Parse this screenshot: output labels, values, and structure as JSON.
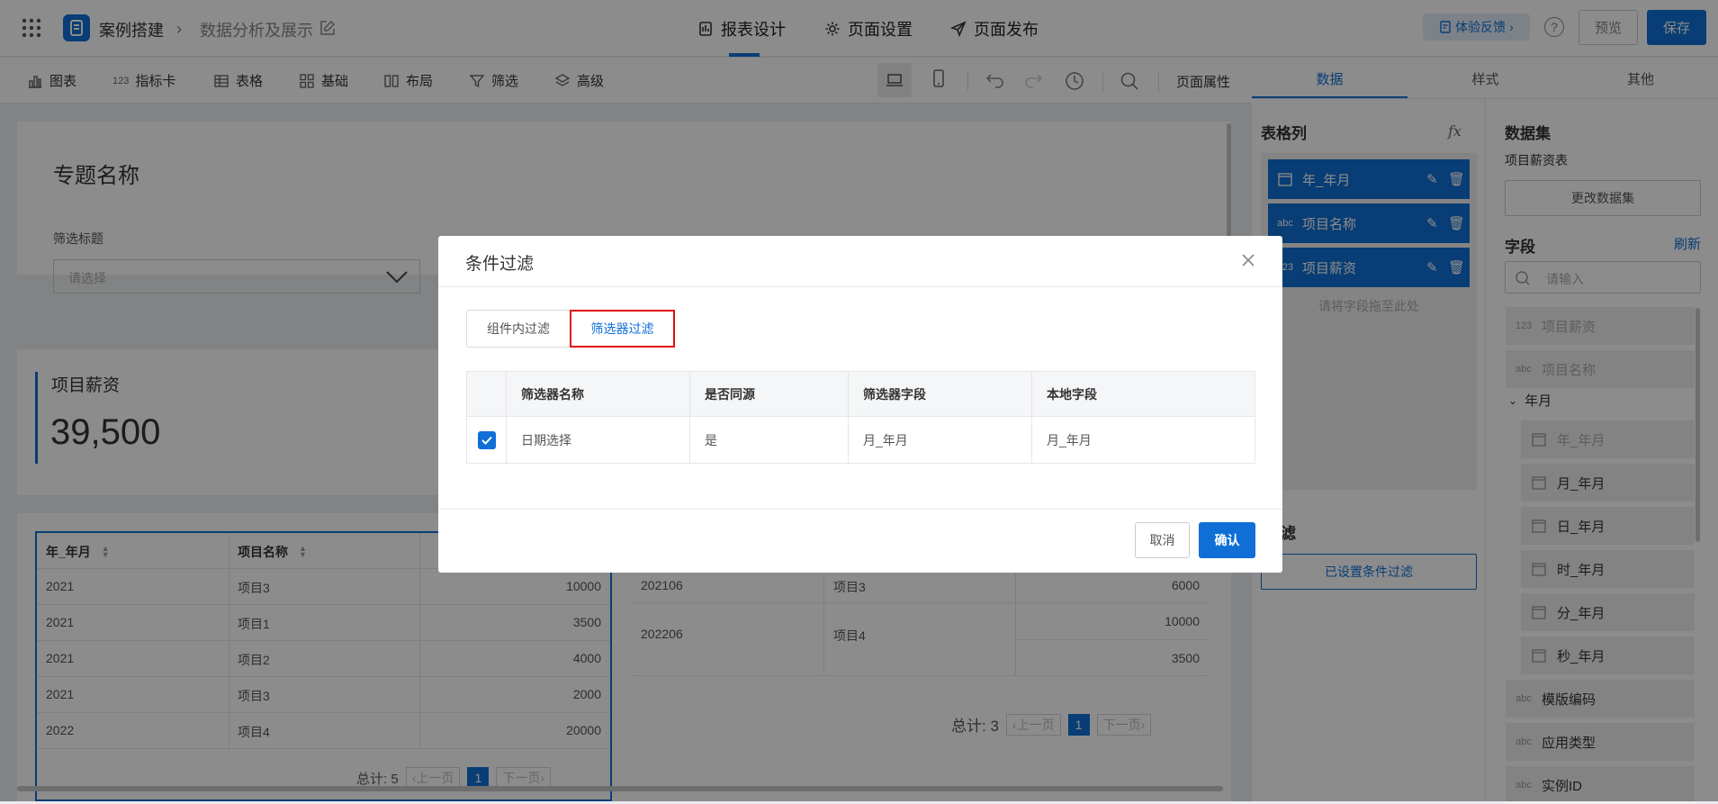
{
  "header": {
    "app_name": "案例搭建",
    "breadcrumb_page": "数据分析及展示",
    "tabs": [
      {
        "label": "报表设计",
        "icon": "report-design-icon",
        "active": true
      },
      {
        "label": "页面设置",
        "icon": "gear-icon",
        "active": false
      },
      {
        "label": "页面发布",
        "icon": "send-icon",
        "active": false
      }
    ],
    "feedback_label": "体验反馈",
    "preview_label": "预览",
    "save_label": "保存",
    "accent_color": "#0f6fd6"
  },
  "toolbar": {
    "items": [
      {
        "label": "图表",
        "icon": "bar-chart-icon"
      },
      {
        "label": "指标卡",
        "icon": "indicator-icon",
        "icon_text": "123"
      },
      {
        "label": "表格",
        "icon": "table-icon"
      },
      {
        "label": "基础",
        "icon": "grid-icon"
      },
      {
        "label": "布局",
        "icon": "layout-icon"
      },
      {
        "label": "筛选",
        "icon": "filter-icon"
      },
      {
        "label": "高级",
        "icon": "layers-icon"
      }
    ],
    "page_props_label": "页面属性"
  },
  "canvas": {
    "topic_title": "专题名称",
    "filter_title": "筛选标题",
    "filter_placeholder": "请选择",
    "kpi_title": "项目薪资",
    "kpi_value": "39,500",
    "left_table": {
      "headers": [
        "年_年月",
        "项目名称",
        ""
      ],
      "rows": [
        [
          "2021",
          "项目3",
          "10000"
        ],
        [
          "2021",
          "项目1",
          "3500"
        ],
        [
          "2021",
          "项目2",
          "4000"
        ],
        [
          "2021",
          "项目3",
          "2000"
        ],
        [
          "2022",
          "项目4",
          "20000"
        ]
      ],
      "total": "总计: 5",
      "prev": "上一页",
      "next": "下一页",
      "page": "1"
    },
    "right_table": {
      "rows": [
        [
          "202106",
          "项目3",
          "6000"
        ],
        [
          "202206",
          "项目4",
          "10000"
        ],
        [
          "",
          "",
          "3500"
        ]
      ],
      "total": "总计: 3",
      "prev": "上一页",
      "next": "下一页",
      "page": "1"
    }
  },
  "right_panel": {
    "tabs": [
      "数据",
      "样式",
      "其他"
    ],
    "columns_title": "表格列",
    "fx_label": "fx",
    "columns": [
      {
        "type": "date",
        "label": "年_年月"
      },
      {
        "type": "abc",
        "label": "项目名称"
      },
      {
        "type": "123",
        "label": "项目薪资"
      }
    ],
    "drop_hint": "请将字段拖至此处",
    "filter_title": "件过滤",
    "filter_set_label": "已设置条件过滤",
    "dataset_title": "数据集",
    "dataset_name": "项目薪资表",
    "change_dataset": "更改数据集",
    "fields_title": "字段",
    "refresh": "刷新",
    "search_placeholder": "请输入",
    "fields": [
      {
        "type": "123",
        "label": "项目薪资",
        "dim": true
      },
      {
        "type": "abc",
        "label": "项目名称",
        "dim": true
      }
    ],
    "group_label": "年月",
    "group_fields": [
      {
        "label": "年_年月",
        "dim": true
      },
      {
        "label": "月_年月",
        "dim": false
      },
      {
        "label": "日_年月",
        "dim": false
      },
      {
        "label": "时_年月",
        "dim": false
      },
      {
        "label": "分_年月",
        "dim": false
      },
      {
        "label": "秒_年月",
        "dim": false
      }
    ],
    "extra_fields": [
      {
        "type": "abc",
        "label": "模版编码"
      },
      {
        "type": "abc",
        "label": "应用类型"
      },
      {
        "type": "abc",
        "label": "实例ID"
      }
    ]
  },
  "dialog": {
    "title": "条件过滤",
    "tabs": [
      "组件内过滤",
      "筛选器过滤"
    ],
    "active_tab": 1,
    "headers": [
      "",
      "筛选器名称",
      "是否同源",
      "筛选器字段",
      "本地字段"
    ],
    "rows": [
      {
        "checked": true,
        "name": "日期选择",
        "same_source": "是",
        "filter_field": "月_年月",
        "local_field": "月_年月"
      }
    ],
    "cancel": "取消",
    "confirm": "确认"
  }
}
